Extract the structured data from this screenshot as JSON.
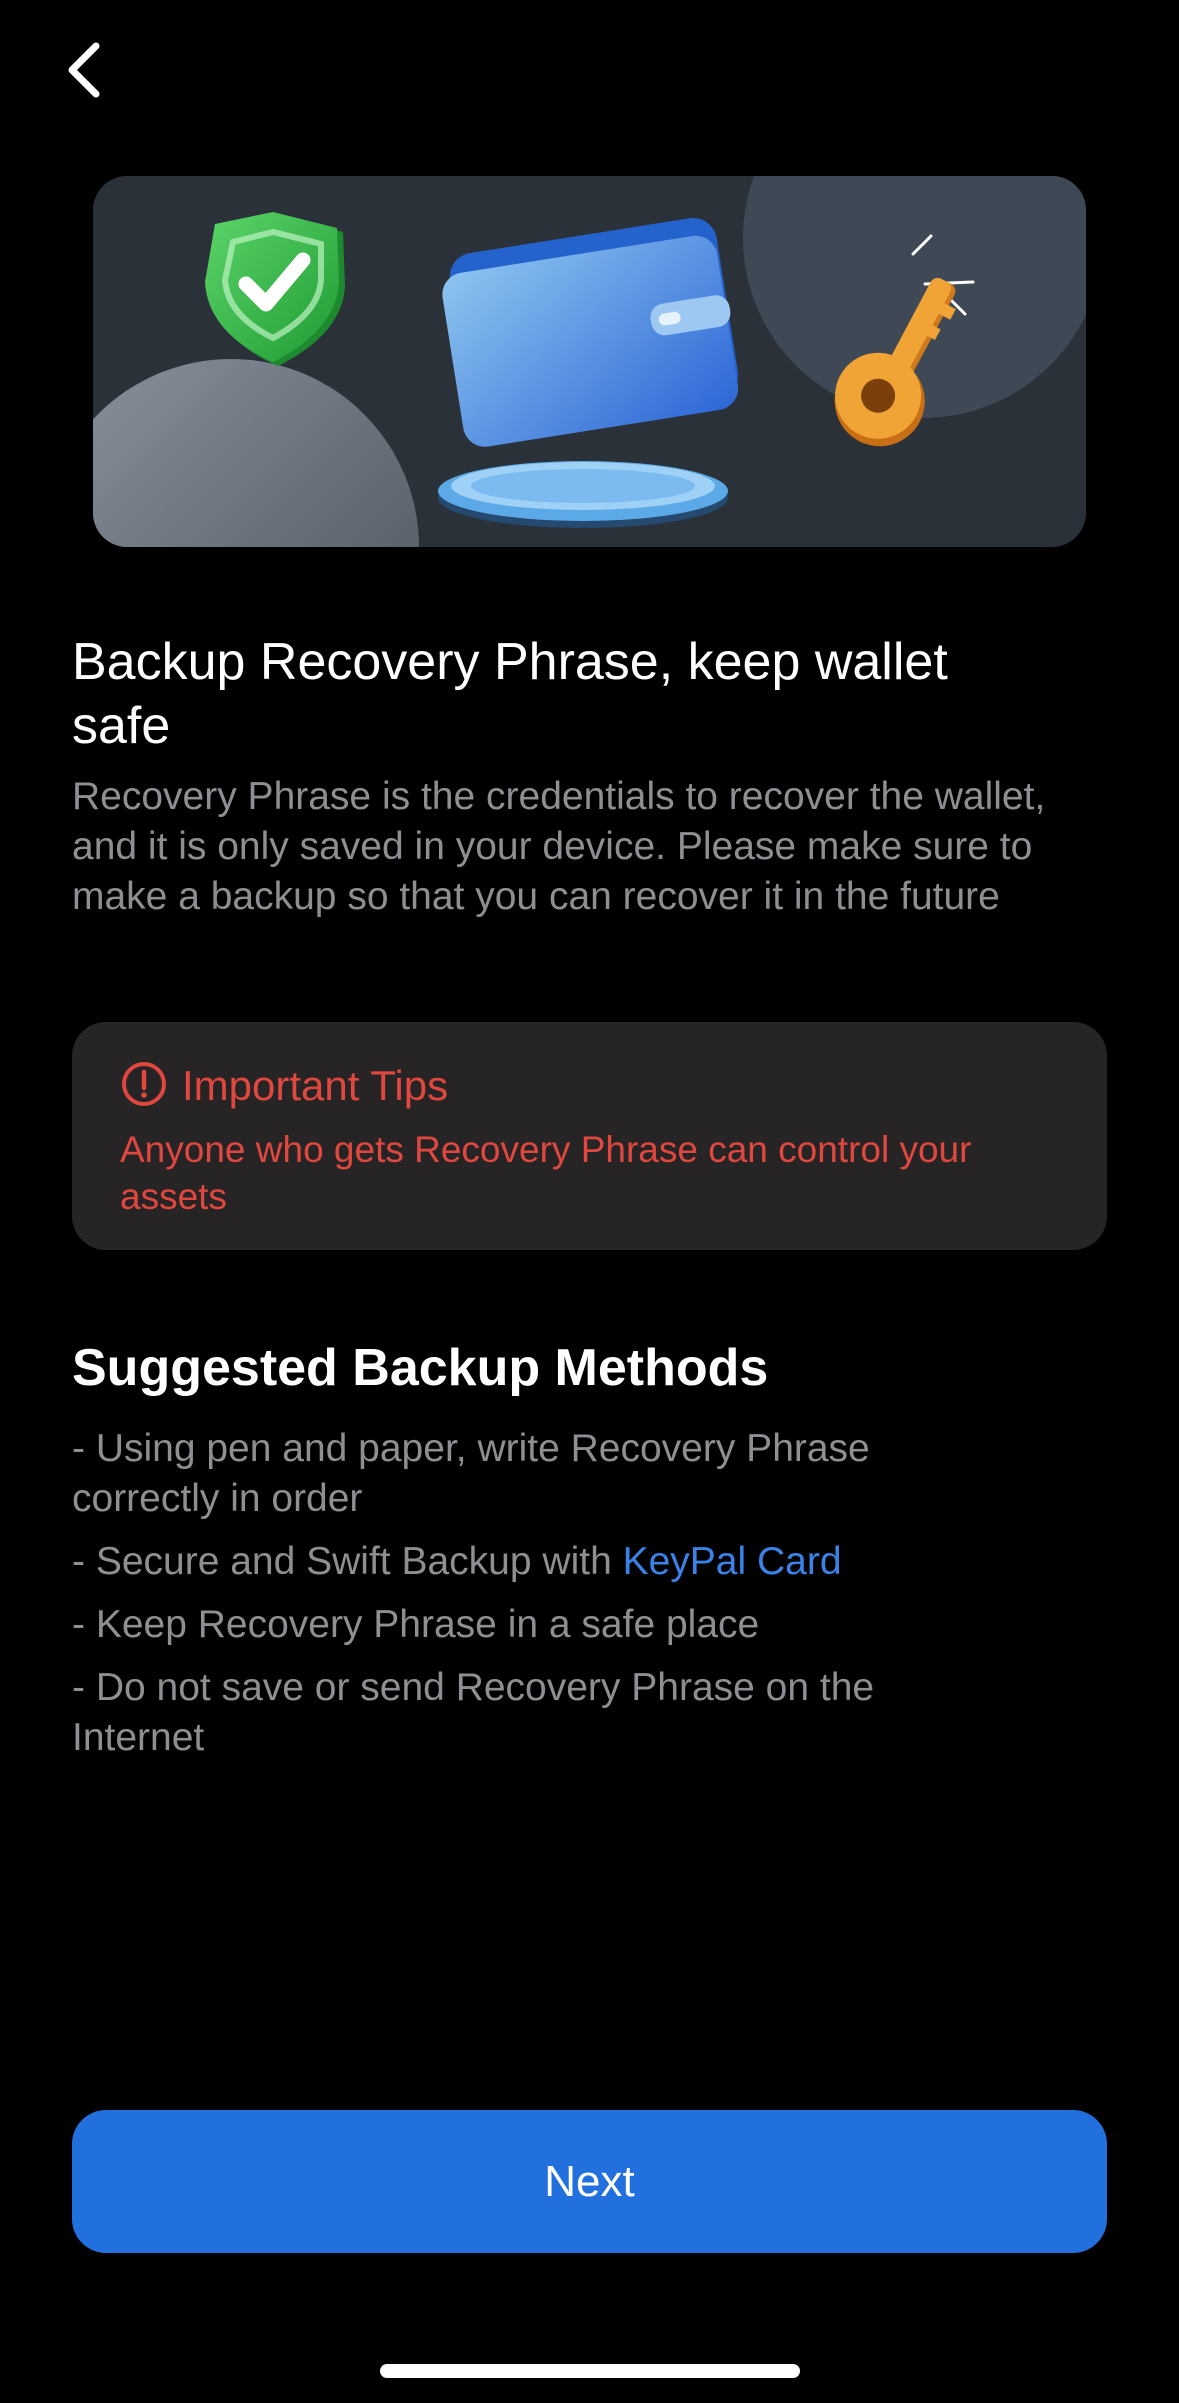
{
  "header": {
    "back_icon": "chevron-left-icon"
  },
  "hero": {
    "icons": [
      "shield-check-icon",
      "wallet-icon",
      "key-icon"
    ],
    "colors": {
      "background": "#2b3138",
      "shield": "#3cb54a",
      "wallet": "#4a90e2",
      "key": "#e8962a"
    }
  },
  "intro": {
    "title": "Backup Recovery Phrase, keep wallet safe",
    "body": "Recovery Phrase is the credentials to recover the wallet, and it is only saved in your device. Please make sure to make a backup so that you can recover it in the future"
  },
  "tips": {
    "icon": "alert-circle-icon",
    "title": "Important Tips",
    "text": "Anyone who gets Recovery Phrase can control your assets",
    "color": "#e0473f"
  },
  "methods": {
    "title": "Suggested Backup Methods",
    "items": [
      {
        "text": "- Using pen and paper, write Recovery Phrase correctly in order"
      },
      {
        "prefix": "- Secure and Swift Backup with ",
        "link": "KeyPal Card"
      },
      {
        "text": "- Keep Recovery Phrase in a safe place"
      },
      {
        "text": "- Do not save or send Recovery Phrase on the Internet"
      }
    ],
    "link_color": "#3b82e8"
  },
  "footer": {
    "next_label": "Next",
    "button_color": "#2170de"
  }
}
